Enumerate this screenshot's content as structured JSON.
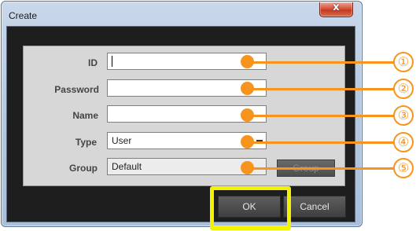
{
  "window": {
    "title": "Create",
    "close_symbol": "x"
  },
  "form": {
    "id": {
      "label": "ID",
      "value": ""
    },
    "password": {
      "label": "Password",
      "value": ""
    },
    "name": {
      "label": "Name",
      "value": ""
    },
    "type": {
      "label": "Type",
      "value": "User"
    },
    "group": {
      "label": "Group",
      "value": "Default",
      "button_label": "Group"
    }
  },
  "buttons": {
    "ok": "OK",
    "cancel": "Cancel"
  },
  "annotations": [
    "①",
    "②",
    "③",
    "④",
    "⑤"
  ],
  "colors": {
    "annotation": "#f7941d",
    "ok_highlight": "#f4f200",
    "client_bg": "#1e1e1e",
    "panel_bg": "#d7d7d7"
  },
  "icons": {
    "close": "close-icon",
    "dropdown": "dropdown-icon"
  }
}
